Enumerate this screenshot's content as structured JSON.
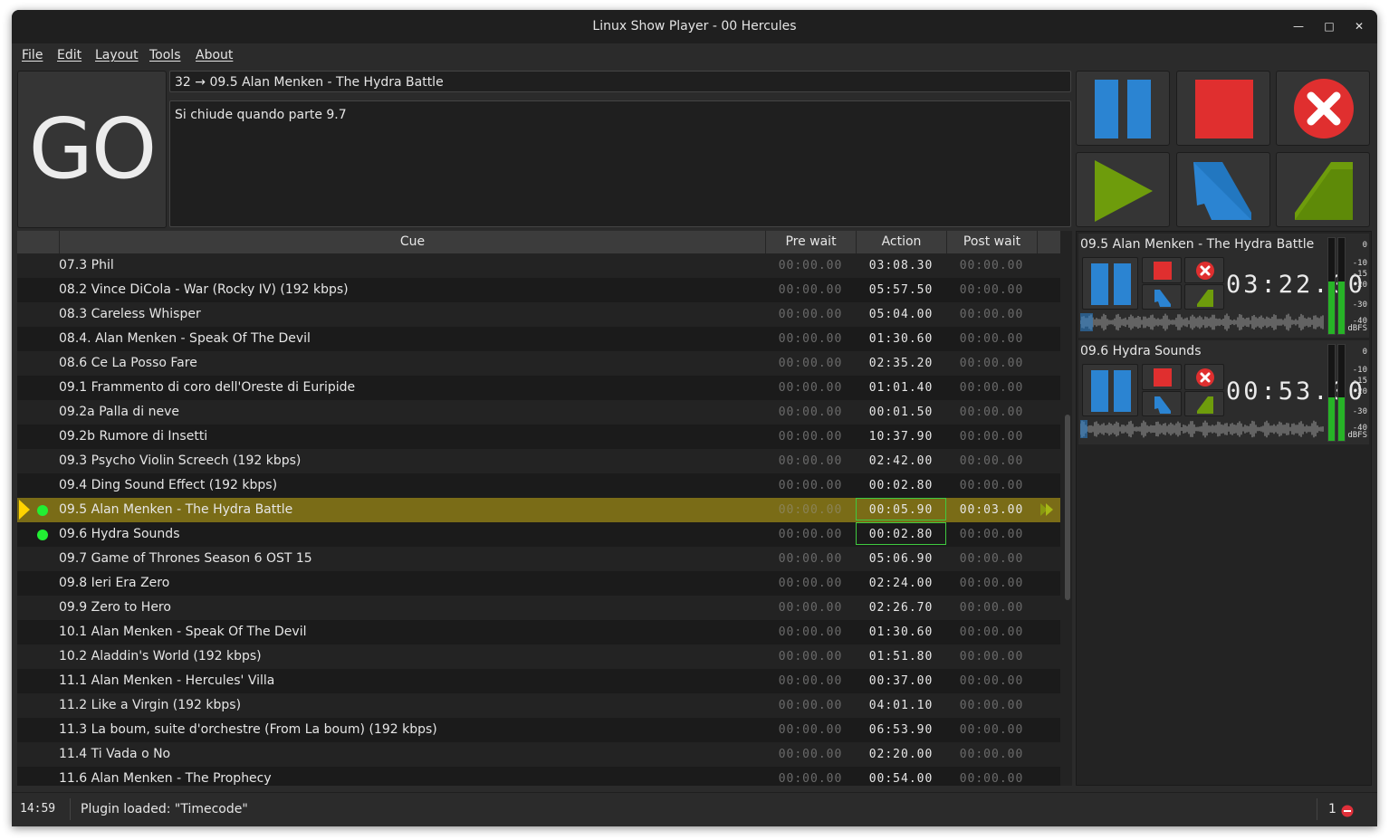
{
  "window": {
    "title": "Linux Show Player - 00 Hercules"
  },
  "menu": [
    "File",
    "Edit",
    "Layout",
    "Tools",
    "About"
  ],
  "go_label": "GO",
  "current_cue": {
    "name": "32 → 09.5 Alan Menken - The Hydra Battle",
    "description": "Si chiude quando parte 9.7"
  },
  "controls": [
    "pause-all",
    "stop-all",
    "interrupt-all",
    "resume-all",
    "fade-out-all",
    "fade-in-all"
  ],
  "colors": {
    "blue": "#2b84d2",
    "red": "#e02f2f",
    "green": "#6e9c0c",
    "selected_row": "#7a6c17",
    "active_green": "#22ee33"
  },
  "list": {
    "columns": {
      "cue": "Cue",
      "pre_wait": "Pre wait",
      "action": "Action",
      "post_wait": "Post wait"
    },
    "rows": [
      {
        "name": "07.3 Phil",
        "pre": "00:00.00",
        "action": "03:08.30",
        "post": "00:00.00"
      },
      {
        "name": "08.2 Vince DiCola - War (Rocky IV) (192  kbps)",
        "pre": "00:00.00",
        "action": "05:57.50",
        "post": "00:00.00"
      },
      {
        "name": "08.3 Careless Whisper",
        "pre": "00:00.00",
        "action": "05:04.00",
        "post": "00:00.00"
      },
      {
        "name": "08.4. Alan Menken - Speak Of The Devil",
        "pre": "00:00.00",
        "action": "01:30.60",
        "post": "00:00.00"
      },
      {
        "name": "08.6 Ce La Posso Fare",
        "pre": "00:00.00",
        "action": "02:35.20",
        "post": "00:00.00"
      },
      {
        "name": "09.1 Frammento di coro dell'Oreste di Euripide",
        "pre": "00:00.00",
        "action": "01:01.40",
        "post": "00:00.00"
      },
      {
        "name": "09.2a Palla di neve",
        "pre": "00:00.00",
        "action": "00:01.50",
        "post": "00:00.00"
      },
      {
        "name": "09.2b Rumore di Insetti",
        "pre": "00:00.00",
        "action": "10:37.90",
        "post": "00:00.00"
      },
      {
        "name": "09.3 Psycho Violin Screech (192  kbps)",
        "pre": "00:00.00",
        "action": "02:42.00",
        "post": "00:00.00"
      },
      {
        "name": "09.4 Ding Sound Effect (192  kbps)",
        "pre": "00:00.00",
        "action": "00:02.80",
        "post": "00:00.00"
      },
      {
        "name": "09.5 Alan Menken - The Hydra Battle",
        "pre": "00:00.00",
        "action": "00:05.90",
        "post": "00:03.00",
        "selected": true,
        "running": true
      },
      {
        "name": "09.6 Hydra Sounds",
        "pre": "00:00.00",
        "action": "00:02.80",
        "post": "00:00.00",
        "running": true
      },
      {
        "name": "09.7 Game of Thrones Season 6 OST 15",
        "pre": "00:00.00",
        "action": "05:06.90",
        "post": "00:00.00"
      },
      {
        "name": "09.8 Ieri Era Zero",
        "pre": "00:00.00",
        "action": "02:24.00",
        "post": "00:00.00"
      },
      {
        "name": "09.9 Zero to Hero",
        "pre": "00:00.00",
        "action": "02:26.70",
        "post": "00:00.00"
      },
      {
        "name": "10.1 Alan Menken - Speak Of The Devil",
        "pre": "00:00.00",
        "action": "01:30.60",
        "post": "00:00.00"
      },
      {
        "name": "10.2 Aladdin's World (192  kbps)",
        "pre": "00:00.00",
        "action": "01:51.80",
        "post": "00:00.00"
      },
      {
        "name": "11.1 Alan Menken - Hercules' Villa",
        "pre": "00:00.00",
        "action": "00:37.00",
        "post": "00:00.00"
      },
      {
        "name": "11.2 Like a Virgin (192  kbps)",
        "pre": "00:00.00",
        "action": "04:01.10",
        "post": "00:00.00"
      },
      {
        "name": "11.3 La boum, suite d'orchestre (From La boum) (192  kbps)",
        "pre": "00:00.00",
        "action": "06:53.90",
        "post": "00:00.00"
      },
      {
        "name": "11.4 Ti Vada o No",
        "pre": "00:00.00",
        "action": "02:20.00",
        "post": "00:00.00"
      },
      {
        "name": "11.6 Alan Menken - The Prophecy",
        "pre": "00:00.00",
        "action": "00:54.00",
        "post": "00:00.00"
      }
    ]
  },
  "running": [
    {
      "title": "09.5 Alan Menken - The Hydra Battle",
      "time": "03:22.00",
      "level": 0.55,
      "progress": 0.05
    },
    {
      "title": "09.6 Hydra Sounds",
      "time": "00:53.00",
      "level": 0.45,
      "progress": 0.03
    }
  ],
  "db_scale": [
    "0",
    "-10",
    "-15",
    "-20",
    "-30",
    "-40",
    "dBFS"
  ],
  "status": {
    "clock": "14:59",
    "message": "Plugin loaded: \"Timecode\"",
    "error_count": "1"
  }
}
